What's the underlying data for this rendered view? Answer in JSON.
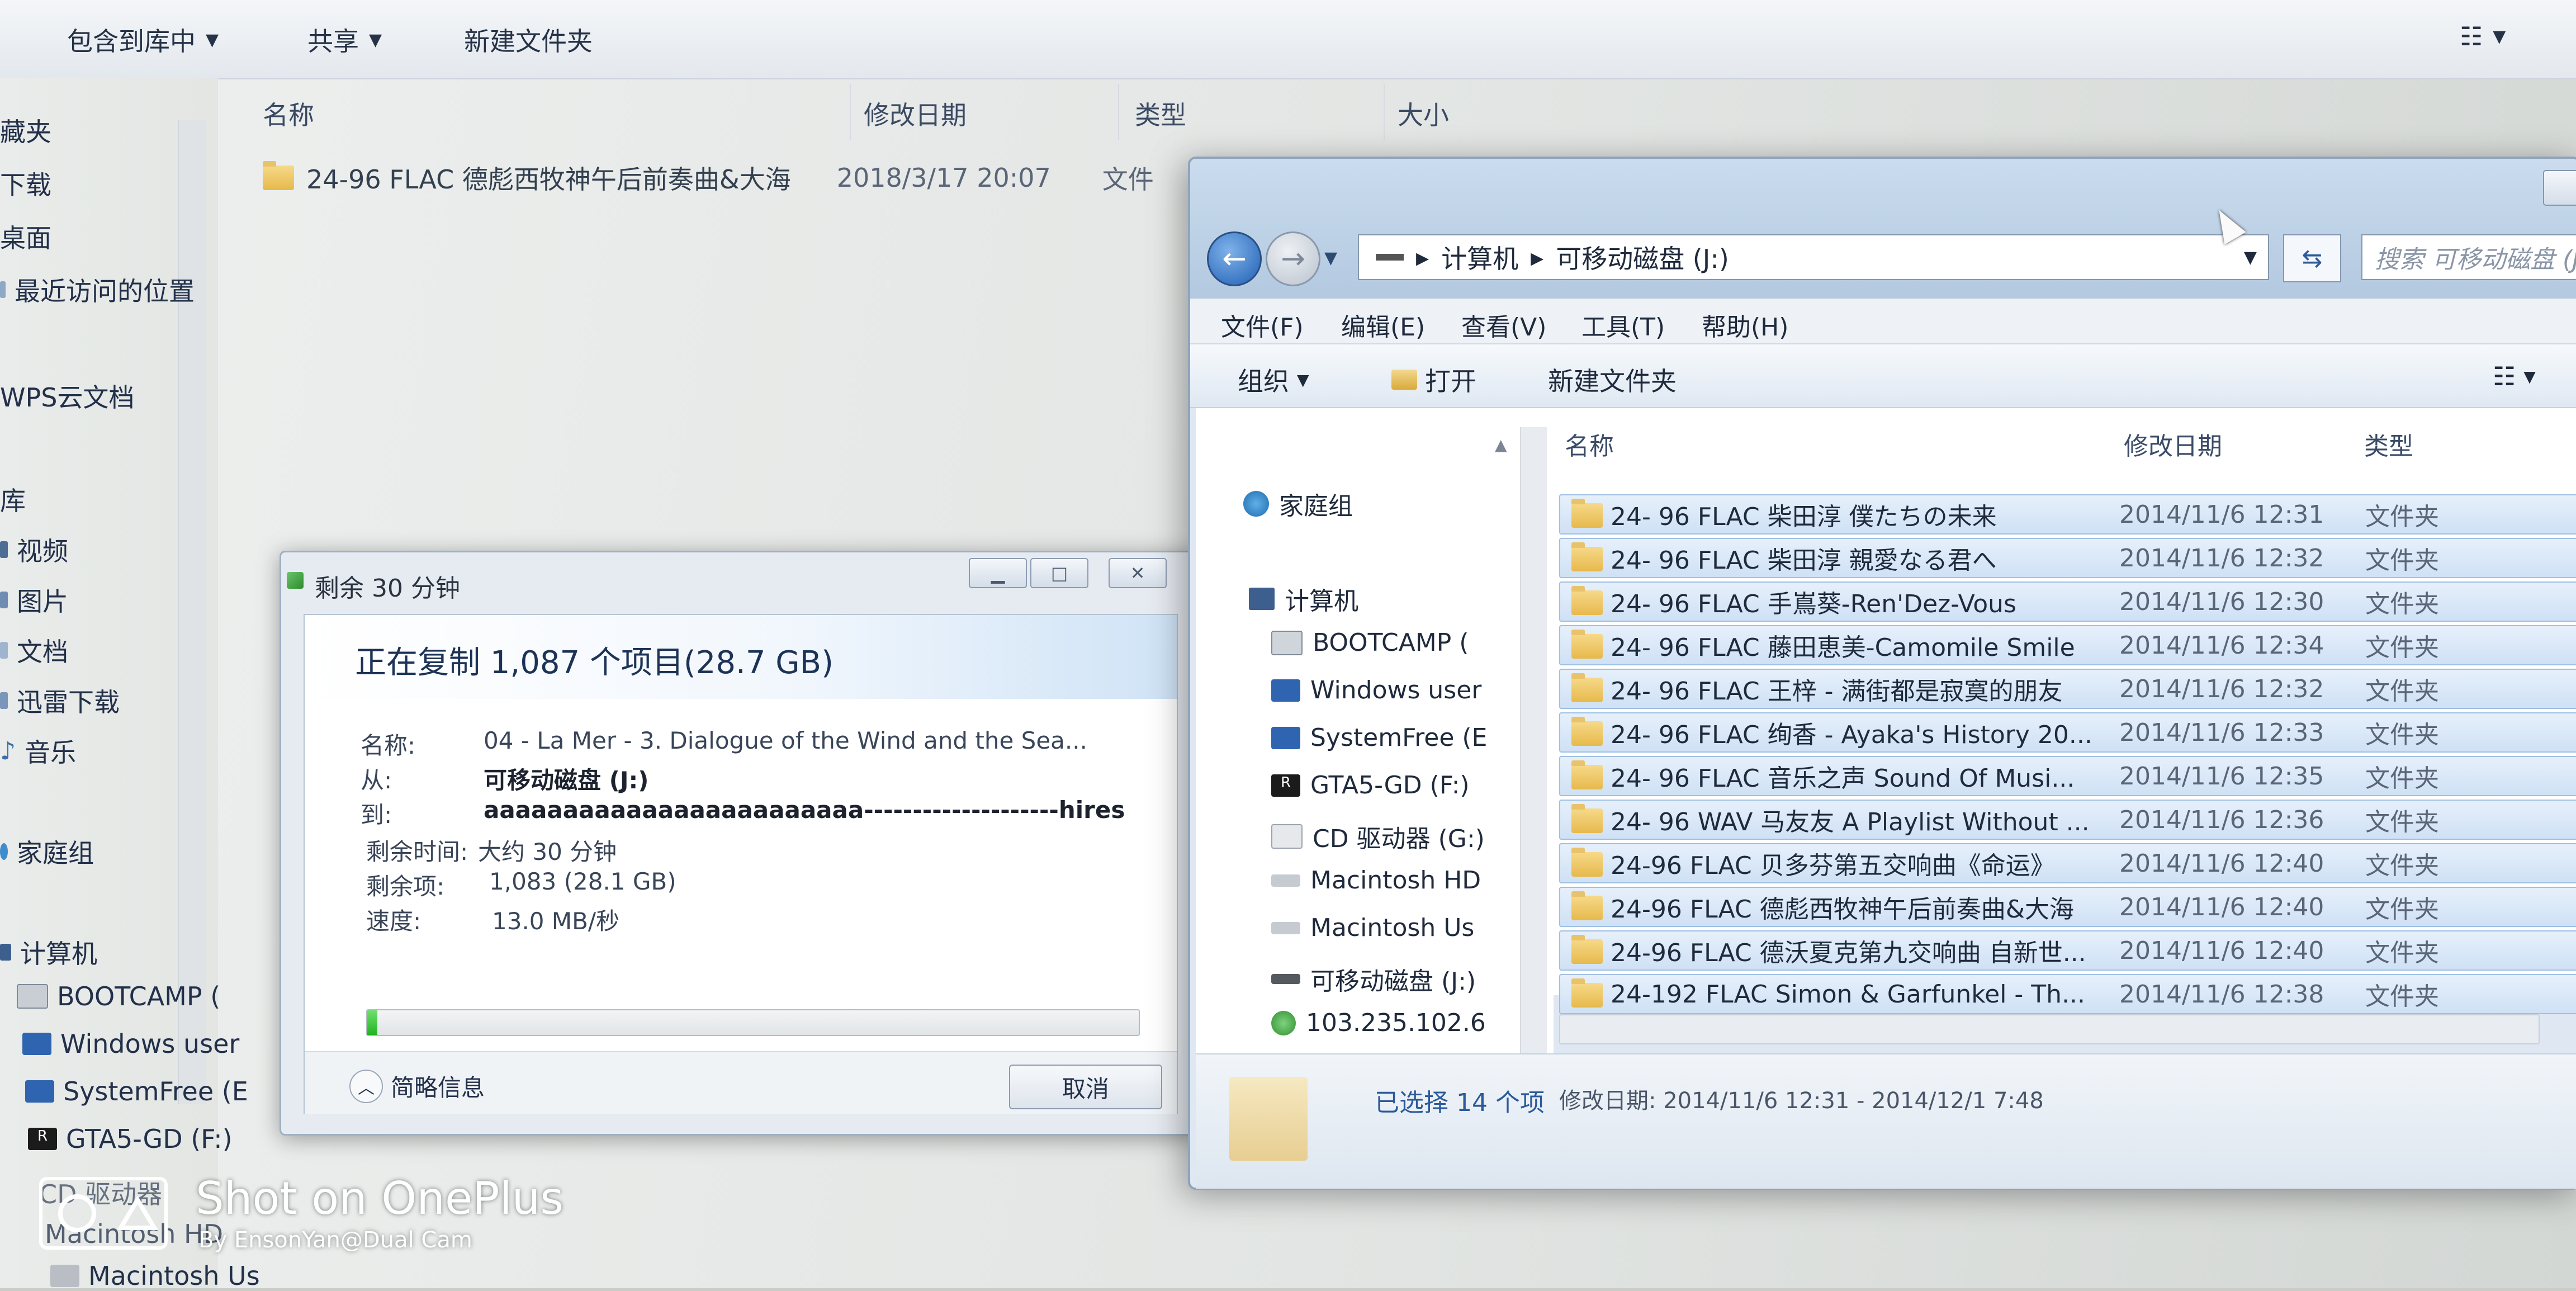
{
  "back_window": {
    "toolbar": {
      "include_library": "包含到库中",
      "share": "共享",
      "new_folder": "新建文件夹"
    },
    "nav_items": [
      "藏夹",
      "下载",
      "桌面",
      "最近访问的位置",
      "WPS云文档",
      "库",
      "视频",
      "图片",
      "文档",
      "迅雷下载",
      "音乐",
      "家庭组",
      "计算机",
      "BOOTCAMP (",
      "Windows user",
      "SystemFree (E",
      "GTA5-GD (F:)",
      "CD 驱动器",
      "Macintosh HD",
      "Macintosh Us"
    ],
    "columns": {
      "name": "名称",
      "modified": "修改日期",
      "type": "类型",
      "size": "大小"
    },
    "row": {
      "name": "24-96 FLAC 德彪西牧神午后前奏曲&大海",
      "modified": "2018/3/17 20:07",
      "type": "文件"
    }
  },
  "copy_dialog": {
    "title": "剩余 30 分钟",
    "headline": "正在复制 1,087 个项目(28.7 GB)",
    "labels": {
      "name": "名称:",
      "from": "从:",
      "to": "到:",
      "time_left": "剩余时间:",
      "items_left": "剩余项:",
      "speed": "速度:"
    },
    "values": {
      "name": "04 - La Mer - 3. Dialogue of the Wind and the Sea...",
      "from": "可移动磁盘 (J:)",
      "to": "aaaaaaaaaaaaaaaaaaaaaaaa--------------------hires",
      "time_left": "大约 30 分钟",
      "items_left": "1,083 (28.1 GB)",
      "speed": "13.0 MB/秒"
    },
    "progress_percent": 1,
    "less_info": "简略信息",
    "cancel": "取消"
  },
  "front_window": {
    "address": {
      "computer": "计算机",
      "drive": "可移动磁盘 (J:)"
    },
    "search_placeholder": "搜索 可移动磁盘 (J:)",
    "menu": [
      "文件(F)",
      "编辑(E)",
      "查看(V)",
      "工具(T)",
      "帮助(H)"
    ],
    "commands": {
      "organize": "组织",
      "open": "打开",
      "new_folder": "新建文件夹"
    },
    "nav": {
      "homegroup": "家庭组",
      "computer": "计算机",
      "drives": [
        "BOOTCAMP (",
        "Windows user",
        "SystemFree (E",
        "GTA5-GD (F:)",
        "CD 驱动器 (G:)",
        "Macintosh HD",
        "Macintosh Us",
        "可移动磁盘 (J:)",
        "103.235.102.6"
      ]
    },
    "columns": {
      "name": "名称",
      "modified": "修改日期",
      "type": "类型"
    },
    "rows": [
      {
        "name": "24- 96 FLAC 柴田淳 僕たちの未来",
        "modified": "2014/11/6 12:31",
        "type": "文件夹"
      },
      {
        "name": "24- 96 FLAC 柴田淳 親愛なる君へ",
        "modified": "2014/11/6 12:32",
        "type": "文件夹"
      },
      {
        "name": "24- 96 FLAC 手嶌葵-Ren'Dez-Vous",
        "modified": "2014/11/6 12:30",
        "type": "文件夹"
      },
      {
        "name": "24- 96 FLAC 藤田恵美-Camomile Smile",
        "modified": "2014/11/6 12:34",
        "type": "文件夹"
      },
      {
        "name": "24- 96 FLAC 王梓 - 满街都是寂寞的朋友",
        "modified": "2014/11/6 12:32",
        "type": "文件夹"
      },
      {
        "name": "24- 96 FLAC 绚香 - Ayaka's History 20...",
        "modified": "2014/11/6 12:33",
        "type": "文件夹"
      },
      {
        "name": "24- 96 FLAC 音乐之声 Sound Of Musi...",
        "modified": "2014/11/6 12:35",
        "type": "文件夹"
      },
      {
        "name": "24- 96 WAV 马友友 A Playlist Without ...",
        "modified": "2014/11/6 12:36",
        "type": "文件夹"
      },
      {
        "name": "24-96 FLAC 贝多芬第五交响曲《命运》",
        "modified": "2014/11/6 12:40",
        "type": "文件夹"
      },
      {
        "name": "24-96 FLAC 德彪西牧神午后前奏曲&大海",
        "modified": "2014/11/6 12:40",
        "type": "文件夹"
      },
      {
        "name": "24-96 FLAC 德沃夏克第九交响曲 自新世...",
        "modified": "2014/11/6 12:40",
        "type": "文件夹"
      },
      {
        "name": "24-192 FLAC Simon & Garfunkel - Th...",
        "modified": "2014/11/6 12:38",
        "type": "文件夹"
      }
    ],
    "status": {
      "selected": "已选择 14 个项",
      "date_range": "修改日期: 2014/11/6 12:31 - 2014/12/1 7:48"
    }
  },
  "watermark": {
    "title": "Shot on OnePlus",
    "byline": "By EnsonYan@Dual Cam"
  },
  "colors": {
    "progress_green": "#21b321",
    "selection_blue": "#cfe1f5",
    "link_blue": "#2b5a9a"
  }
}
